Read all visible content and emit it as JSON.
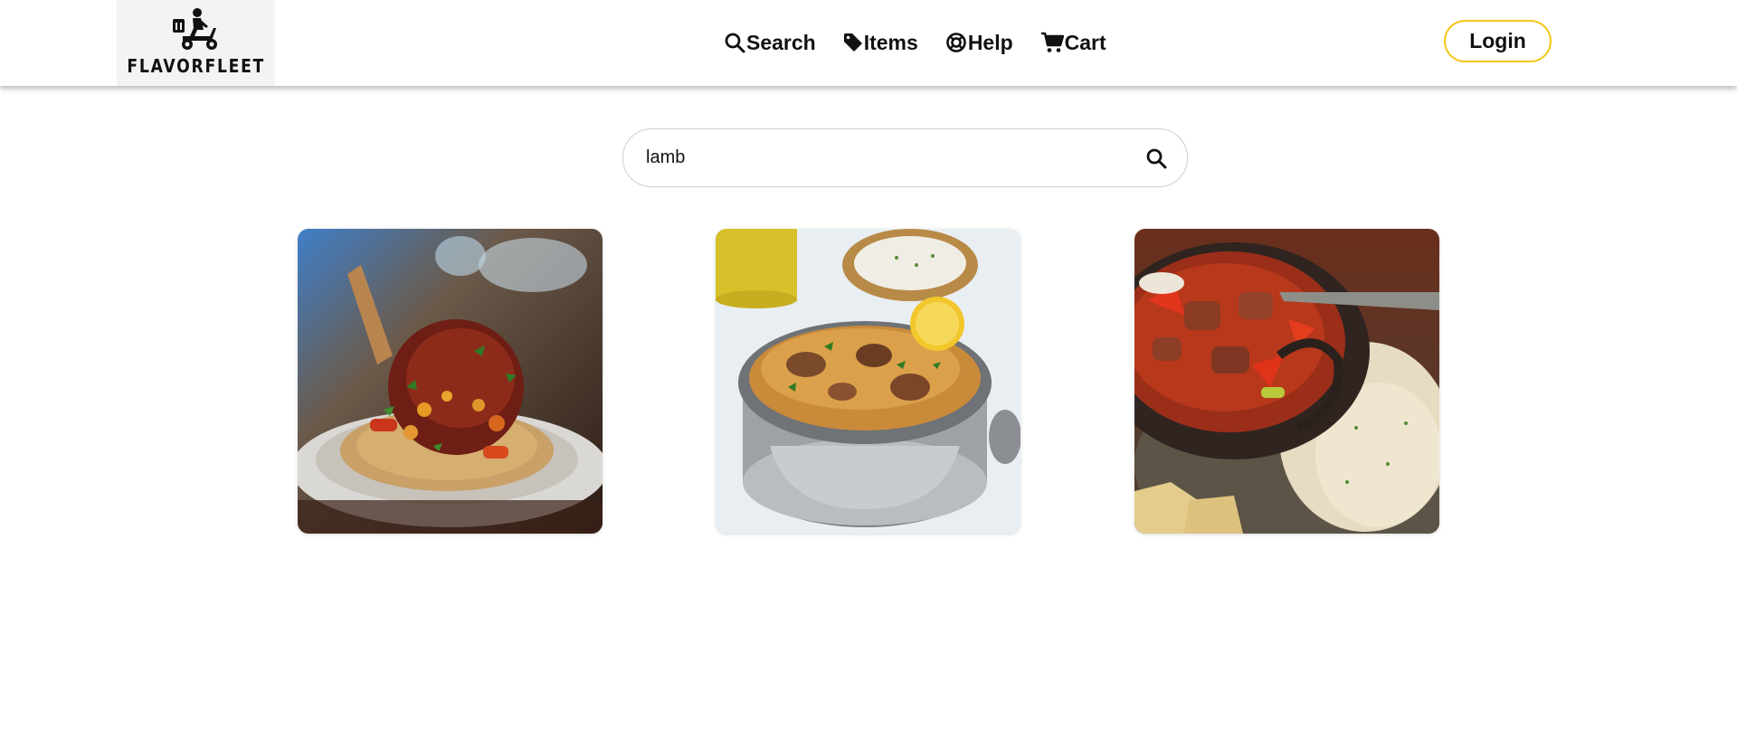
{
  "brand": {
    "name": "FLAVORFLEET",
    "logo_icon": "delivery-scooter-icon"
  },
  "nav": {
    "items": [
      {
        "label": "Search",
        "icon": "search-icon"
      },
      {
        "label": "Items",
        "icon": "tag-icon"
      },
      {
        "label": "Help",
        "icon": "lifebuoy-icon"
      },
      {
        "label": "Cart",
        "icon": "cart-icon"
      }
    ],
    "login_label": "Login"
  },
  "search": {
    "value": "lamb",
    "button_icon": "search-icon"
  },
  "colors": {
    "accent": "#f5c518",
    "text": "#111111",
    "background": "#ffffff"
  },
  "results": [
    {
      "image": "lamb-shank-couscous-image"
    },
    {
      "image": "lamb-biryani-image"
    },
    {
      "image": "lamb-curry-rice-image"
    }
  ]
}
